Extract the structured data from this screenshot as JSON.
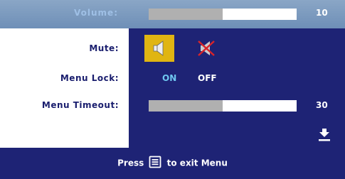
{
  "volume": {
    "label": "Volume:",
    "value": "10",
    "level": 0.5
  },
  "mute": {
    "label": "Mute:",
    "on_icon": "speaker-icon",
    "off_icon": "speaker-muted-icon"
  },
  "menu_lock": {
    "label": "Menu Lock:",
    "on": "ON",
    "off": "OFF"
  },
  "menu_timeout": {
    "label": "Menu Timeout:",
    "value": "30",
    "level": 0.5
  },
  "scroll_icon": "arrow-down-icon",
  "footer": {
    "press": "Press",
    "exit": "to exit Menu",
    "key_icon": "menu-key-icon"
  },
  "colors": {
    "panel": "#1e2375",
    "highlight": "#e0b512",
    "selected_text": "#6fc7f0",
    "header": "#7a98bf"
  }
}
